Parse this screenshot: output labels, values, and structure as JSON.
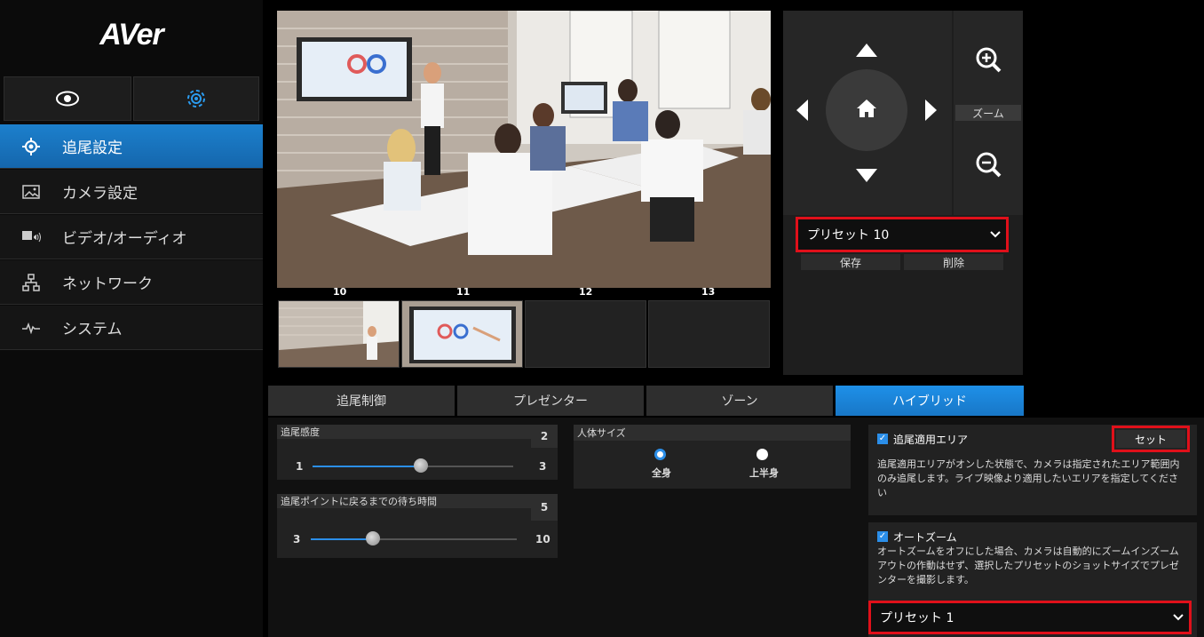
{
  "brand": "AVer",
  "sidebar": {
    "top_tabs": [
      {
        "icon": "eye-icon"
      },
      {
        "icon": "gear-icon"
      }
    ],
    "items": [
      {
        "label": "追尾設定",
        "icon": "crosshair-icon",
        "active": true
      },
      {
        "label": "カメラ設定",
        "icon": "image-icon",
        "active": false
      },
      {
        "label": "ビデオ/オーディオ",
        "icon": "video-audio-icon",
        "active": false
      },
      {
        "label": "ネットワーク",
        "icon": "network-icon",
        "active": false
      },
      {
        "label": "システム",
        "icon": "pulse-icon",
        "active": false
      }
    ]
  },
  "thumbnails": {
    "numbers": [
      "10",
      "11",
      "12",
      "13"
    ]
  },
  "ptz": {
    "zoom_label": "ズーム",
    "preset_select": "プリセット 10",
    "save_label": "保存",
    "delete_label": "削除"
  },
  "tabs": [
    {
      "label": "追尾制御",
      "active": false
    },
    {
      "label": "プレゼンター",
      "active": false
    },
    {
      "label": "ゾーン",
      "active": false
    },
    {
      "label": "ハイブリッド",
      "active": true
    }
  ],
  "settings": {
    "tracking_sensitivity": {
      "label": "追尾感度",
      "value": "2",
      "min": "1",
      "max": "3"
    },
    "return_wait": {
      "label": "追尾ポイントに戻るまでの待ち時間",
      "value": "5",
      "min": "3",
      "max": "10"
    },
    "body_size": {
      "label": "人体サイズ",
      "options": [
        {
          "label": "全身",
          "selected": true
        },
        {
          "label": "上半身",
          "selected": false
        }
      ]
    },
    "tracking_area": {
      "label": "追尾適用エリア",
      "checked": true,
      "set_button": "セット",
      "description": "追尾適用エリアがオンした状態で、カメラは指定されたエリア範囲内のみ追尾します。ライブ映像より適用したいエリアを指定してください"
    },
    "auto_zoom": {
      "label": "オートズーム",
      "checked": true,
      "description": "オートズームをオフにした場合、カメラは自動的にズームインズームアウトの作動はせず、選択したプリセットのショットサイズでプレゼンターを撮影します。",
      "preset_select": "プリセット 1"
    }
  },
  "colors": {
    "accent": "#1c80cd",
    "highlight": "#e0101a"
  }
}
